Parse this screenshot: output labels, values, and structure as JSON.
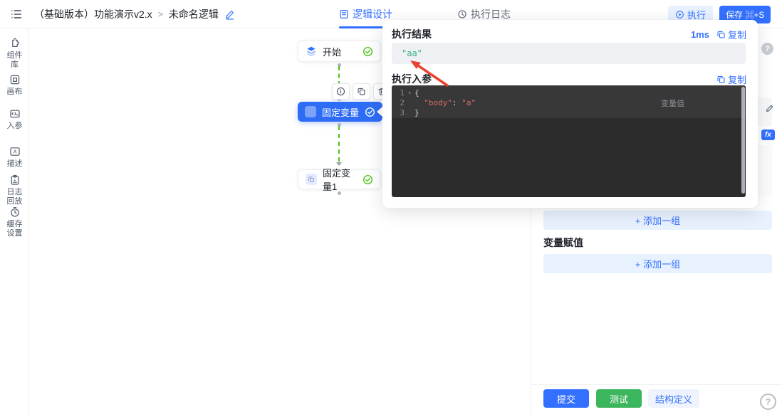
{
  "colors": {
    "accent": "#3370ff",
    "success": "#52c41a",
    "node_selected": "#2f6cf6",
    "editor_bg": "#2c2c2c"
  },
  "header": {
    "breadcrumb": {
      "project": "（基础版本）功能演示v2.x",
      "separator": ">",
      "page": "未命名逻辑"
    },
    "tabs": [
      {
        "label": "逻辑设计"
      },
      {
        "label": "执行日志"
      }
    ],
    "run_label": "执行",
    "save_label": "保存 ⌘+S"
  },
  "sidebar": {
    "items": [
      {
        "icon": "puzzle-icon",
        "label": "组件库"
      },
      {
        "icon": "canvas-icon",
        "label": "画布"
      },
      {
        "icon": "input-params-icon",
        "label": "入参"
      },
      {
        "icon": "description-icon",
        "label": "描述"
      },
      {
        "icon": "log-replay-icon",
        "label": "日志回放"
      },
      {
        "icon": "cache-settings-icon",
        "label": "缓存设置"
      }
    ]
  },
  "canvas": {
    "nodes": [
      {
        "label": "开始"
      },
      {
        "label": "固定变量"
      },
      {
        "label": "固定变量1"
      }
    ],
    "toolbar_icons": [
      "info-icon",
      "copy-icon",
      "delete-icon"
    ]
  },
  "modal": {
    "result_title": "执行结果",
    "duration": "1ms",
    "copy_label": "复制",
    "result_value": "\"aa\"",
    "params_title": "执行入参",
    "editor": {
      "line_numbers": [
        "1",
        "2",
        "3"
      ],
      "fold_caret": "▾",
      "open_brace": "{",
      "indent": "  ",
      "key": "\"body\"",
      "colon": ": ",
      "value": "\"a\"",
      "close_brace": "}",
      "overlay_label": "变量值"
    }
  },
  "right_panel": {
    "help_label": "?",
    "fx_label": "fx",
    "add_group_label": "+ 添加一组",
    "assign_title": "变量赋值",
    "footer": {
      "submit": "提交",
      "test": "测试",
      "schema": "结构定义"
    }
  }
}
